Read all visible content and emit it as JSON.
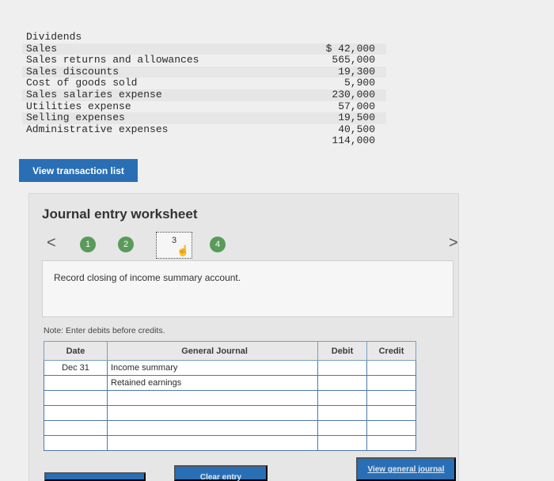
{
  "accounts": [
    {
      "name": "Dividends",
      "value": ""
    },
    {
      "name": "Sales",
      "value": "$ 42,000"
    },
    {
      "name": "Sales returns and allowances",
      "value": "565,000"
    },
    {
      "name": "Sales discounts",
      "value": "19,300"
    },
    {
      "name": "Cost of goods sold",
      "value": "5,900"
    },
    {
      "name": "Sales salaries expense",
      "value": "230,000"
    },
    {
      "name": "Utilities expense",
      "value": "57,000"
    },
    {
      "name": "Selling expenses",
      "value": "19,500"
    },
    {
      "name": "Administrative expenses",
      "value": "40,500"
    },
    {
      "name": "",
      "value": "114,000"
    }
  ],
  "view_transaction_label": "View transaction list",
  "worksheet": {
    "title": "Journal entry worksheet",
    "prev": "<",
    "next": ">",
    "steps": [
      "1",
      "2",
      "3",
      "4"
    ],
    "current_step": "3",
    "hand_glyph": "☝",
    "task": "Record closing of income summary account.",
    "note": "Note: Enter debits before credits."
  },
  "journal": {
    "headers": {
      "date": "Date",
      "general_journal": "General Journal",
      "debit": "Debit",
      "credit": "Credit"
    },
    "rows": [
      {
        "date": "Dec 31",
        "desc": "Income summary",
        "debit": "",
        "credit": ""
      },
      {
        "date": "",
        "desc": "Retained earnings",
        "debit": "",
        "credit": ""
      },
      {
        "date": "",
        "desc": "",
        "debit": "",
        "credit": ""
      },
      {
        "date": "",
        "desc": "",
        "debit": "",
        "credit": ""
      },
      {
        "date": "",
        "desc": "",
        "debit": "",
        "credit": ""
      },
      {
        "date": "",
        "desc": "",
        "debit": "",
        "credit": ""
      }
    ]
  },
  "buttons": {
    "record_entry": "",
    "clear_entry": "Clear entry",
    "view_general_journal": "View general journal"
  }
}
